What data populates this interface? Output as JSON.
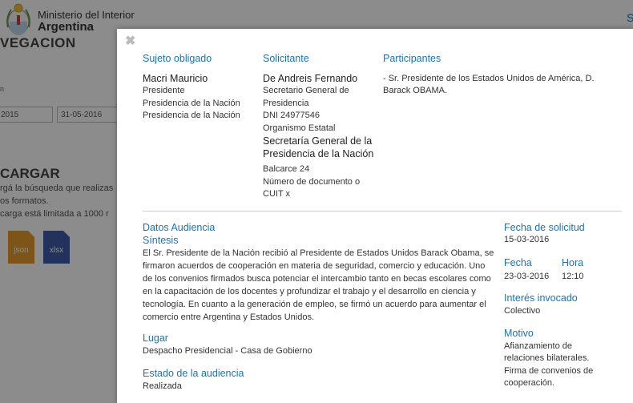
{
  "bg": {
    "ministry_line1": "Ministerio del Interior",
    "ministry_line2": "Argentina",
    "right_link": "S",
    "section_title": "VEGACION",
    "small_label": "n",
    "date_from": "2015",
    "date_to": "31-05-2016",
    "download_title": "CARGAR",
    "desc_1": "rgá la búsqueda que realizas",
    "desc_2": "os formatos.",
    "desc_3": "carga está limitada a 1000 r",
    "file_json": "json",
    "file_xlsx": "xlsx"
  },
  "modal": {
    "close": "✖",
    "sujeto": {
      "header": "Sujeto obligado",
      "name": "Macri Mauricio",
      "cargo": "Presidente",
      "org1": "Presidencia de la Nación",
      "org2": "Presidencia de la Nación"
    },
    "solicitante": {
      "header": "Solicitante",
      "name": "De Andreis Fernando",
      "cargo_1": "Secretario General de",
      "cargo_2": "Presidencia",
      "dni": "DNI 24977546",
      "tipo": "Organismo Estatal",
      "org_1": "Secretaría General de la",
      "org_2": "Presidencia de la Nación",
      "direccion": "Balcarce 24",
      "doc_1": "Número de documento o",
      "doc_2": "CUIT x"
    },
    "participantes": {
      "header": "Participantes",
      "line_1": "- Sr. Presidente de los Estados Unidos de América, D.",
      "line_2": "Barack OBAMA."
    },
    "audiencia": {
      "header": "Datos Audiencia",
      "sintesis_label": "Síntesis",
      "sintesis_text": "El Sr. Presidente de la Nación recibió al Presidente de Estados Unidos Barack Obama, se firmaron acuerdos de cooperación en materia de seguridad, comercio y educación. Uno de los convenios firmados busca potenciar el intercambio tanto en becas escolares como en la capacitación de los docentes y profundizar el trabajo y el desarrollo en ciencia y tecnología. En cuanto a la generación de empleo, se firmó un acuerdo para aumentar el comercio entre Argentina y Estados Unidos.",
      "lugar_label": "Lugar",
      "lugar_value": "Despacho Presidencial - Casa de Gobierno",
      "estado_label": "Estado de la audiencia",
      "estado_value": "Realizada"
    },
    "side": {
      "fecha_solicitud_label": "Fecha de solicitud",
      "fecha_solicitud_value": "15-03-2016",
      "fecha_label": "Fecha",
      "fecha_value": "23-03-2016",
      "hora_label": "Hora",
      "hora_value": "12:10",
      "interes_label": "Interés invocado",
      "interes_value": "Colectivo",
      "motivo_label": "Motivo",
      "motivo_1": "Afianzamiento de",
      "motivo_2": "relaciones bilaterales.",
      "motivo_3": "Firma de convenios de",
      "motivo_4": "cooperación."
    }
  }
}
